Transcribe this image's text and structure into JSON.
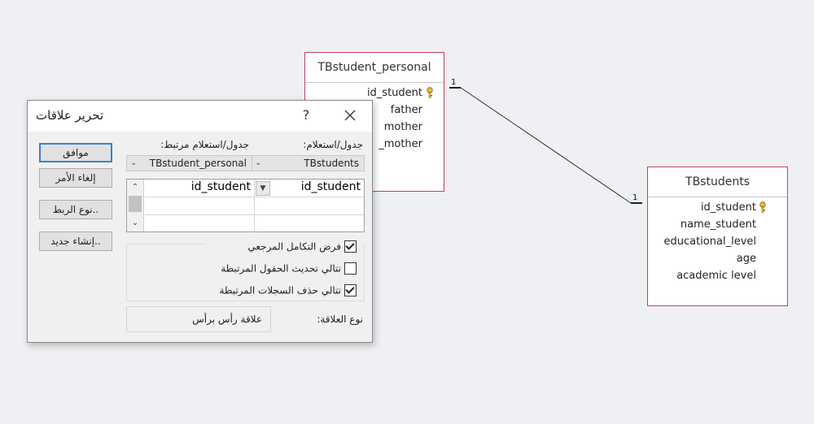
{
  "tables": {
    "personal": {
      "title": "TBstudent_personal",
      "fields": [
        "id_student",
        "father",
        "mother",
        "_mother"
      ],
      "key_icon": "key-icon"
    },
    "students": {
      "title": "TBstudents",
      "fields": [
        "id_student",
        "name_student",
        "educational_level",
        "age",
        "academic level"
      ],
      "key_icon": "key-icon"
    }
  },
  "relationship": {
    "end_left": "1",
    "end_right": "1"
  },
  "dialog": {
    "title": "تحرير علاقات",
    "help": "?",
    "buttons": {
      "ok": "موافق",
      "cancel": "إلغاء الأمر",
      "join_type": "نوع الربط..",
      "create_new": "إنشاء جديد.."
    },
    "table_label": "جدول/استعلام:",
    "related_table_label": "جدول/استعلام مرتبط:",
    "table_value": "TBstudents",
    "related_table_value": "TBstudent_personal",
    "grid": {
      "left_field": "id_student",
      "right_field": "id_student"
    },
    "checks": [
      {
        "label": "فرض التكامل المرجعي",
        "checked": true
      },
      {
        "label": "تتالي تحديث الحقول المرتبطة",
        "checked": false
      },
      {
        "label": "تتالي حذف السجلات المرتبطة",
        "checked": true
      }
    ],
    "relationship_type_label": "نوع العلاقة:",
    "relationship_type_value": "علاقة رأس برأس"
  }
}
